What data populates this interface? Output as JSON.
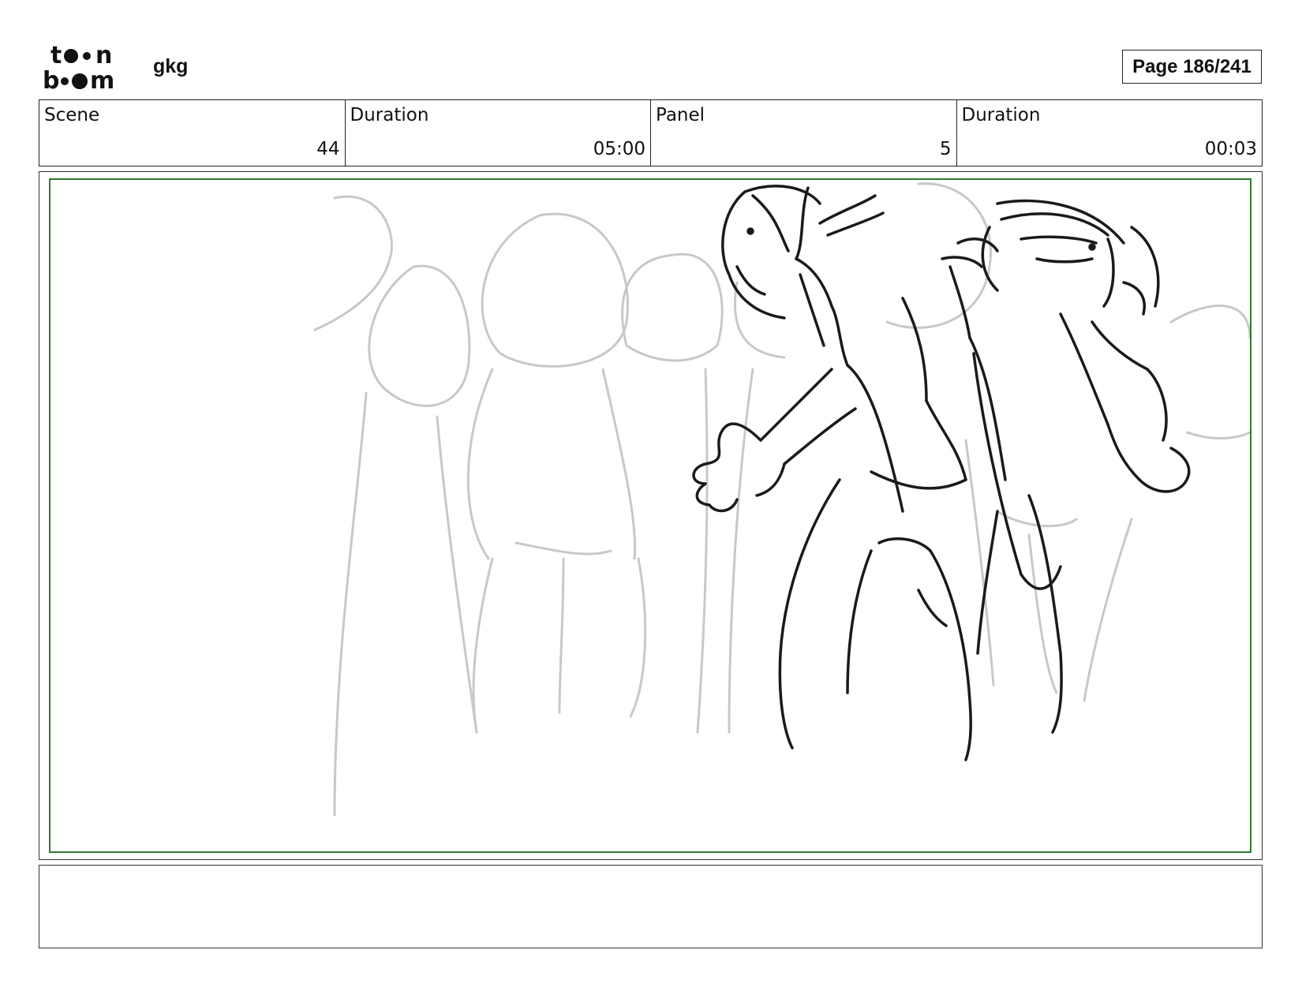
{
  "logo": {
    "line1": "toon",
    "line2": "boom",
    "icon": "toon-boom-logo"
  },
  "project_name": "gkg",
  "page_indicator": "Page 186/241",
  "info_bar": [
    {
      "label": "Scene",
      "value": "44"
    },
    {
      "label": "Duration",
      "value": "05:00"
    },
    {
      "label": "Panel",
      "value": "5"
    },
    {
      "label": "Duration",
      "value": "00:03"
    }
  ],
  "panel": {
    "safe_area_color": "#2f7a2f"
  },
  "notes": {
    "text": ""
  }
}
